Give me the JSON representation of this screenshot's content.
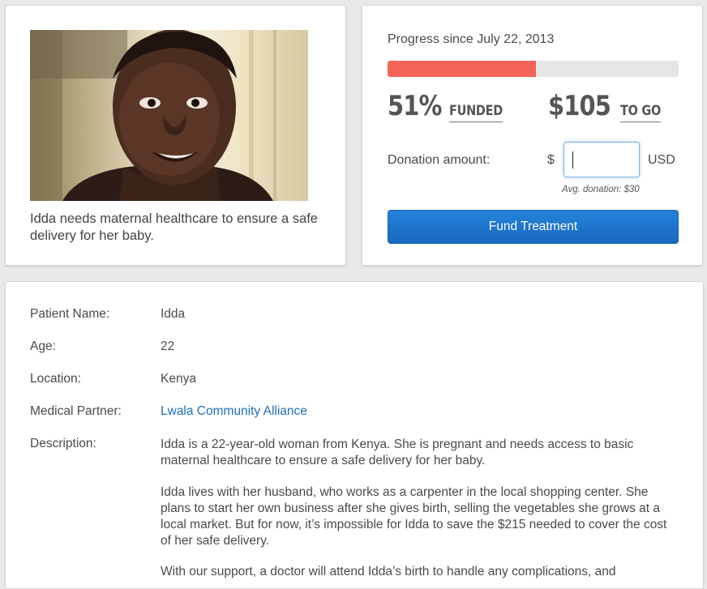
{
  "patient_card": {
    "caption": "Idda needs maternal healthcare to ensure a safe delivery for her baby."
  },
  "progress": {
    "title": "Progress since July 22, 2013",
    "funded_percent": 51,
    "funded_value": "51%",
    "funded_label": "FUNDED",
    "to_go_value": "$105",
    "to_go_label": "TO GO",
    "bar_color": "#f46457",
    "track_color": "#e5e5e5"
  },
  "donation": {
    "label": "Donation amount:",
    "currency_symbol": "$",
    "input_value": "",
    "currency_code": "USD",
    "avg_note": "Avg. donation: $30",
    "button_label": "Fund Treatment",
    "button_color": "#1f74cd"
  },
  "details": {
    "rows": [
      {
        "label": "Patient Name:",
        "value": "Idda"
      },
      {
        "label": "Age:",
        "value": "22"
      },
      {
        "label": "Location:",
        "value": "Kenya"
      },
      {
        "label": "Medical Partner:",
        "value": "Lwala Community Alliance"
      }
    ],
    "description_label": "Description:",
    "description": [
      "Idda is a 22-year-old woman from Kenya. She is pregnant and needs access to basic maternal healthcare to ensure a safe delivery for her baby.",
      "Idda lives with her husband, who works as a carpenter in the local shopping center. She plans to start her own business after she gives birth, selling the vegetables she grows at a local market. But for now, it’s impossible for Idda to save the $215 needed to cover the cost of her safe delivery.",
      "With our support, a doctor will attend Idda’s birth to handle any complications, and"
    ],
    "link_color": "#1f6fb7"
  }
}
